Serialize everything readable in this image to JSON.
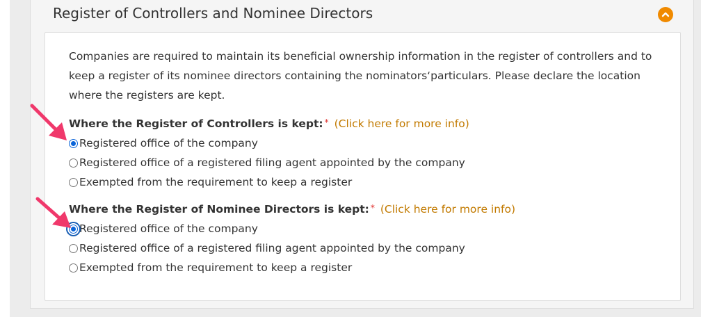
{
  "section": {
    "title": "Register of Controllers and Nominee Directors",
    "collapse_icon": "chevron-up-icon",
    "accent_color": "#f08a00"
  },
  "intro_text": "Companies are required to maintain its beneficial ownership information in the register of controllers and to keep a register of its nominee directors containing the nominators‘particulars. Please declare the location where the registers are kept.",
  "controllers": {
    "question": "Where the Register of Controllers is kept:",
    "required_mark": "*",
    "info_link": "(Click here for more info)",
    "options": [
      {
        "label": "Registered office of the company",
        "checked": true
      },
      {
        "label": "Registered office of a registered filing agent appointed by the company",
        "checked": false
      },
      {
        "label": "Exempted from the requirement to keep a register",
        "checked": false
      }
    ]
  },
  "nominee_directors": {
    "question": "Where the Register of Nominee Directors is kept:",
    "required_mark": "*",
    "info_link": "(Click here for more info)",
    "options": [
      {
        "label": "Registered office of the company",
        "checked": true
      },
      {
        "label": "Registered office of a registered filing agent appointed by the company",
        "checked": false
      },
      {
        "label": "Exempted from the requirement to keep a register",
        "checked": false
      }
    ]
  },
  "annotation_color": "#f0386b",
  "link_color": "#c27a00"
}
